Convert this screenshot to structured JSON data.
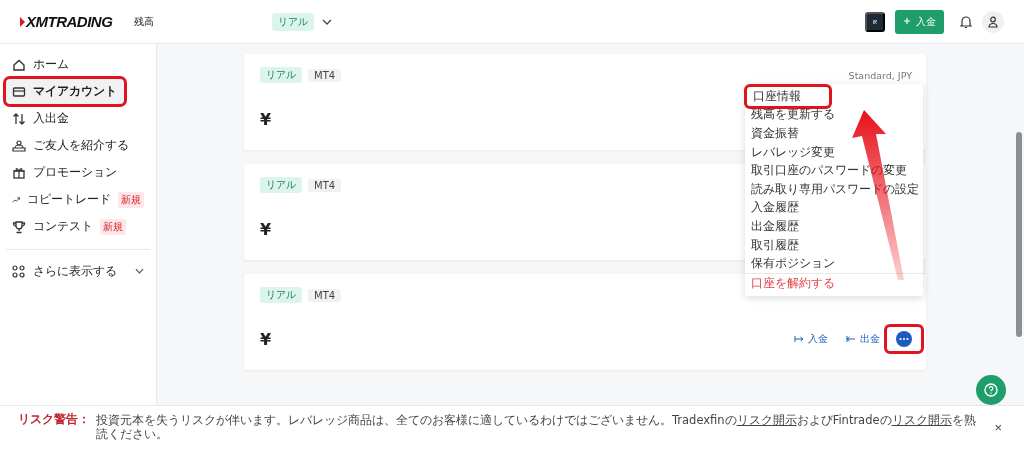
{
  "header": {
    "logo": "XMTRADING",
    "balance_label": "残高",
    "account_badge": "リアル",
    "deposit_button": "入金"
  },
  "sidebar": {
    "items": [
      {
        "label": "ホーム",
        "selected": false,
        "highlighted": false
      },
      {
        "label": "マイアカウント",
        "selected": true,
        "highlighted": true
      },
      {
        "label": "入出金",
        "selected": false,
        "highlighted": false
      },
      {
        "label": "ご友人を紹介する",
        "selected": false,
        "highlighted": false
      },
      {
        "label": "プロモーション",
        "selected": false,
        "highlighted": false
      },
      {
        "label": "コピートレード",
        "selected": false,
        "highlighted": false,
        "badge": "新規"
      },
      {
        "label": "コンテスト",
        "selected": false,
        "highlighted": false,
        "badge": "新規"
      }
    ],
    "more": "さらに表示する"
  },
  "accounts": [
    {
      "tags": [
        {
          "label": "リアル",
          "kind": "real"
        },
        {
          "label": "MT4",
          "kind": "platform"
        }
      ],
      "currency": "¥",
      "spec": "Standard, JPY"
    },
    {
      "tags": [
        {
          "label": "リアル",
          "kind": "real"
        },
        {
          "label": "MT4",
          "kind": "platform"
        }
      ],
      "currency": "¥"
    },
    {
      "tags": [
        {
          "label": "リアル",
          "kind": "real"
        },
        {
          "label": "MT4",
          "kind": "platform"
        }
      ],
      "currency": "¥",
      "actions": [
        {
          "label": "入金",
          "kind": "deposit"
        },
        {
          "label": "出金",
          "kind": "withdraw"
        }
      ],
      "more_highlighted": true
    }
  ],
  "account_menu": {
    "items": [
      {
        "label": "口座情報",
        "kind": "normal",
        "highlighted": true
      },
      {
        "label": "残高を更新する",
        "kind": "normal",
        "highlighted": false
      },
      {
        "label": "資金振替",
        "kind": "normal",
        "highlighted": false
      },
      {
        "label": "レバレッジ変更",
        "kind": "normal",
        "highlighted": false
      },
      {
        "label": "取引口座のパスワードの変更",
        "kind": "normal",
        "highlighted": false
      },
      {
        "label": "読み取り専用パスワードの設定",
        "kind": "normal",
        "highlighted": false
      },
      {
        "label": "入金履歴",
        "kind": "normal",
        "highlighted": false
      },
      {
        "label": "出金履歴",
        "kind": "normal",
        "highlighted": false
      },
      {
        "label": "取引履歴",
        "kind": "normal",
        "highlighted": false
      },
      {
        "label": "保有ポジション",
        "kind": "normal",
        "highlighted": false
      },
      {
        "label": "口座を解約する",
        "kind": "danger",
        "highlighted": false
      }
    ]
  },
  "risk_warning": {
    "label": "リスク警告：",
    "parts": [
      {
        "text": "投資元本を失うリスクが伴います。レバレッジ商品は、全てのお客様に適しているわけではございません。Tradexfinの",
        "kind": "text"
      },
      {
        "text": "リスク開示",
        "kind": "link"
      },
      {
        "text": "およびFintradeの",
        "kind": "text"
      },
      {
        "text": "リスク開示",
        "kind": "link"
      },
      {
        "text": "を熟読ください。",
        "kind": "text"
      }
    ],
    "close": "×"
  }
}
